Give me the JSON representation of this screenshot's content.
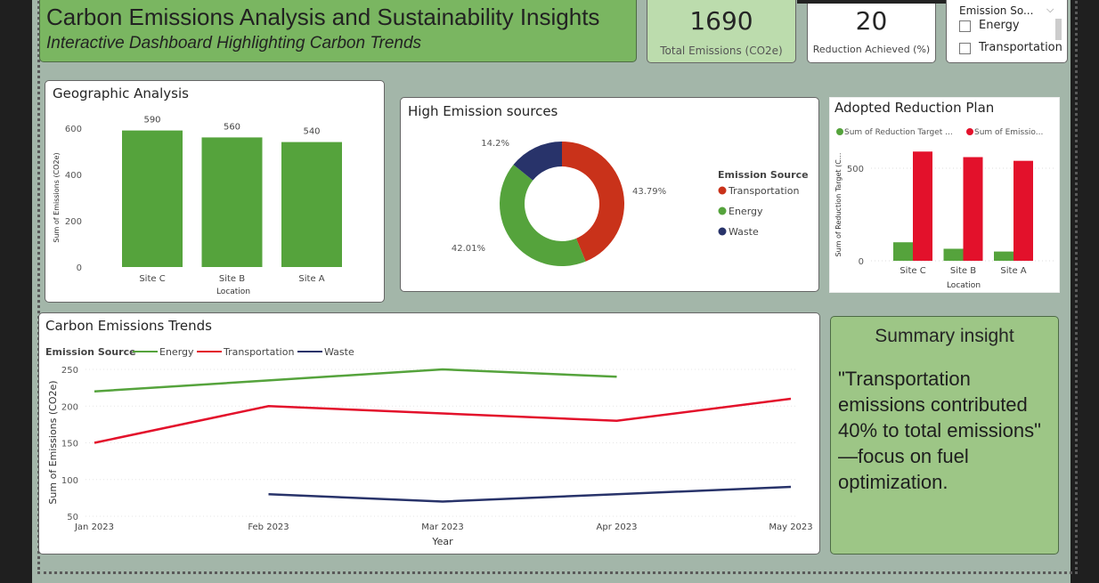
{
  "header": {
    "title": "Carbon Emissions Analysis and Sustainability Insights",
    "subtitle": "Interactive Dashboard Highlighting Carbon Trends"
  },
  "kpis": [
    {
      "value": "1690",
      "label": "Total Emissions (CO2e)"
    },
    {
      "value": "20",
      "label": "Reduction Achieved (%)"
    }
  ],
  "slicer": {
    "title": "Emission So...",
    "options": [
      "Energy",
      "Transportation"
    ]
  },
  "summary": {
    "title": "Summary insight",
    "text": "\"Transportation emissions contributed 40% to total emissions\" —focus on fuel optimization."
  },
  "colors": {
    "energy": "#55a33c",
    "transportation": "#e3112b",
    "waste": "#28336a",
    "donut_transport": "#c9321a",
    "background": "#a3b6a9",
    "header": "#7ab661"
  },
  "chart_data": [
    {
      "type": "bar",
      "title": "Geographic Analysis",
      "xlabel": "Location",
      "ylabel": "Sum of Emissions (CO2e)",
      "categories": [
        "Site C",
        "Site B",
        "Site A"
      ],
      "values": [
        590,
        560,
        540
      ],
      "ylim": [
        0,
        600
      ],
      "yticks": [
        0,
        200,
        400,
        600
      ],
      "color": "#55a33c"
    },
    {
      "type": "pie",
      "title": "High Emission sources",
      "legend_title": "Emission Source",
      "legend_position": "right",
      "slices": [
        {
          "name": "Transportation",
          "value": 43.79,
          "label": "43.79%",
          "color": "#c9321a"
        },
        {
          "name": "Energy",
          "value": 42.01,
          "label": "42.01%",
          "color": "#55a33c"
        },
        {
          "name": "Waste",
          "value": 14.2,
          "label": "14.2%",
          "color": "#28336a"
        }
      ]
    },
    {
      "type": "bar",
      "title": "Adopted Reduction Plan",
      "xlabel": "Location",
      "ylabel": "Sum of Reduction Target (C...",
      "categories": [
        "Site C",
        "Site B",
        "Site A"
      ],
      "ylim": [
        0,
        600
      ],
      "yticks": [
        0,
        500
      ],
      "legend_position": "top-left",
      "series": [
        {
          "name": "Sum of Reduction Target ...",
          "values": [
            100,
            65,
            50
          ],
          "color": "#55a33c"
        },
        {
          "name": "Sum of Emissio...",
          "values": [
            590,
            560,
            540
          ],
          "color": "#e3112b"
        }
      ]
    },
    {
      "type": "line",
      "title": "Carbon Emissions Trends",
      "legend_title": "Emission Source",
      "legend_position": "top-left",
      "xlabel": "Year",
      "ylabel": "Sum of Emissions (CO2e)",
      "x": [
        "Jan 2023",
        "Feb 2023",
        "Mar 2023",
        "Apr 2023",
        "May 2023"
      ],
      "ylim": [
        50,
        250
      ],
      "yticks": [
        50,
        100,
        150,
        200,
        250
      ],
      "series": [
        {
          "name": "Energy",
          "values": [
            220,
            235,
            250,
            240,
            null
          ],
          "color": "#55a33c"
        },
        {
          "name": "Transportation",
          "values": [
            150,
            200,
            190,
            180,
            210
          ],
          "color": "#e3112b"
        },
        {
          "name": "Waste",
          "values": [
            null,
            80,
            70,
            80,
            90
          ],
          "color": "#28336a"
        }
      ]
    }
  ]
}
